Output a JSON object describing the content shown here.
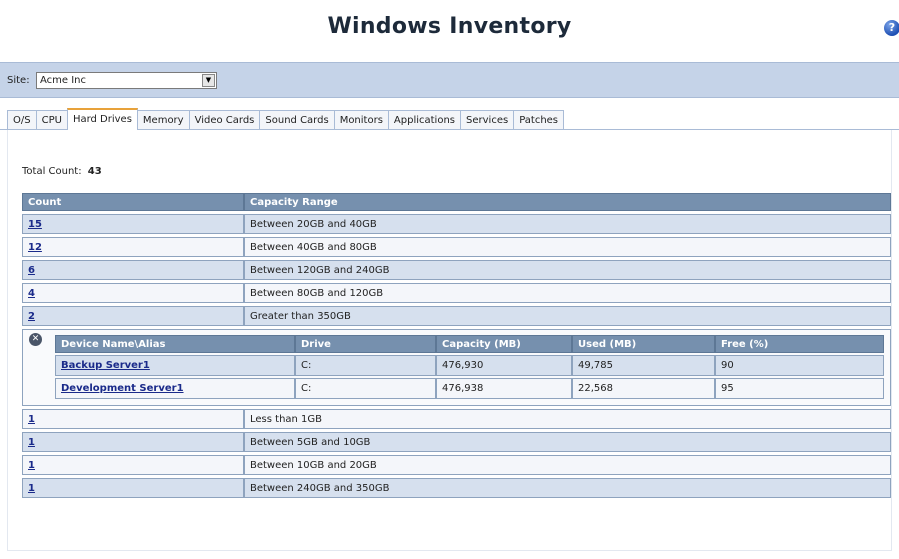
{
  "header": {
    "title": "Windows Inventory",
    "help_icon": "help-icon"
  },
  "site": {
    "label": "Site:",
    "selected": "Acme Inc"
  },
  "tabs": [
    "O/S",
    "CPU",
    "Hard Drives",
    "Memory",
    "Video Cards",
    "Sound Cards",
    "Monitors",
    "Applications",
    "Services",
    "Patches"
  ],
  "active_tab": "Hard Drives",
  "summary": {
    "total_label": "Total Count:",
    "total_value": "43"
  },
  "table": {
    "headers": [
      "Count",
      "Capacity Range"
    ],
    "rows_before": [
      {
        "count": "15",
        "range": "Between 20GB and 40GB"
      },
      {
        "count": "12",
        "range": "Between 40GB and 80GB"
      },
      {
        "count": "6",
        "range": "Between 120GB and 240GB"
      },
      {
        "count": "4",
        "range": "Between 80GB and 120GB"
      },
      {
        "count": "2",
        "range": "Greater than 350GB"
      }
    ],
    "detail": {
      "headers": [
        "Device Name\\Alias",
        "Drive",
        "Capacity (MB)",
        "Used (MB)",
        "Free (%)"
      ],
      "rows": [
        {
          "device": "Backup Server1",
          "drive": "C:",
          "capacity": "476,930",
          "used": "49,785",
          "free": "90"
        },
        {
          "device": "Development Server1",
          "drive": "C:",
          "capacity": "476,938",
          "used": "22,568",
          "free": "95"
        }
      ]
    },
    "rows_after": [
      {
        "count": "1",
        "range": "Less than 1GB"
      },
      {
        "count": "1",
        "range": "Between 5GB and 10GB"
      },
      {
        "count": "1",
        "range": "Between 10GB and 20GB"
      },
      {
        "count": "1",
        "range": "Between 240GB and 350GB"
      }
    ]
  }
}
